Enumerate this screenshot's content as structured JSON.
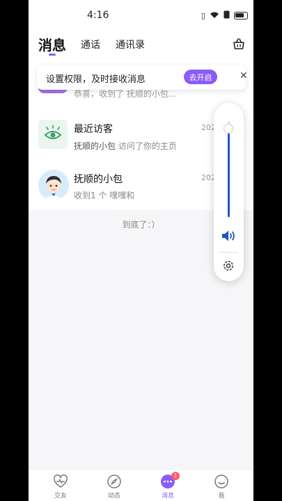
{
  "status_bar": {
    "time": "4:16"
  },
  "header": {
    "tabs": [
      {
        "label": "消息",
        "active": true
      },
      {
        "label": "通话",
        "active": false
      },
      {
        "label": "通讯录",
        "active": false
      }
    ],
    "basket_icon": "basket-icon"
  },
  "permission_banner": {
    "text": "设置权限，及时接收消息",
    "button": "去开启"
  },
  "messages": {
    "partial_row_preview": "恭喜，收到了 抚顺的小包...",
    "items": [
      {
        "title": "最近访客",
        "sender": "抚顺的小包",
        "preview": "访问了你的主页",
        "date": "202"
      },
      {
        "title": "抚顺的小包",
        "sender": "",
        "preview": "收到1 个 嘿嘿和",
        "date": "202"
      }
    ],
    "end_text": "到底了：）"
  },
  "volume": {
    "level": 0.92
  },
  "bottom_nav": {
    "items": [
      {
        "label": "交友",
        "icon": "heart-pulse-icon"
      },
      {
        "label": "动态",
        "icon": "compass-icon"
      },
      {
        "label": "消息",
        "icon": "chat-icon",
        "badge": "1",
        "active": true
      },
      {
        "label": "我",
        "icon": "smile-icon"
      }
    ]
  },
  "colors": {
    "accent": "#8a5cf6",
    "volume": "#1f55c9",
    "badge": "#ff5a6a"
  }
}
